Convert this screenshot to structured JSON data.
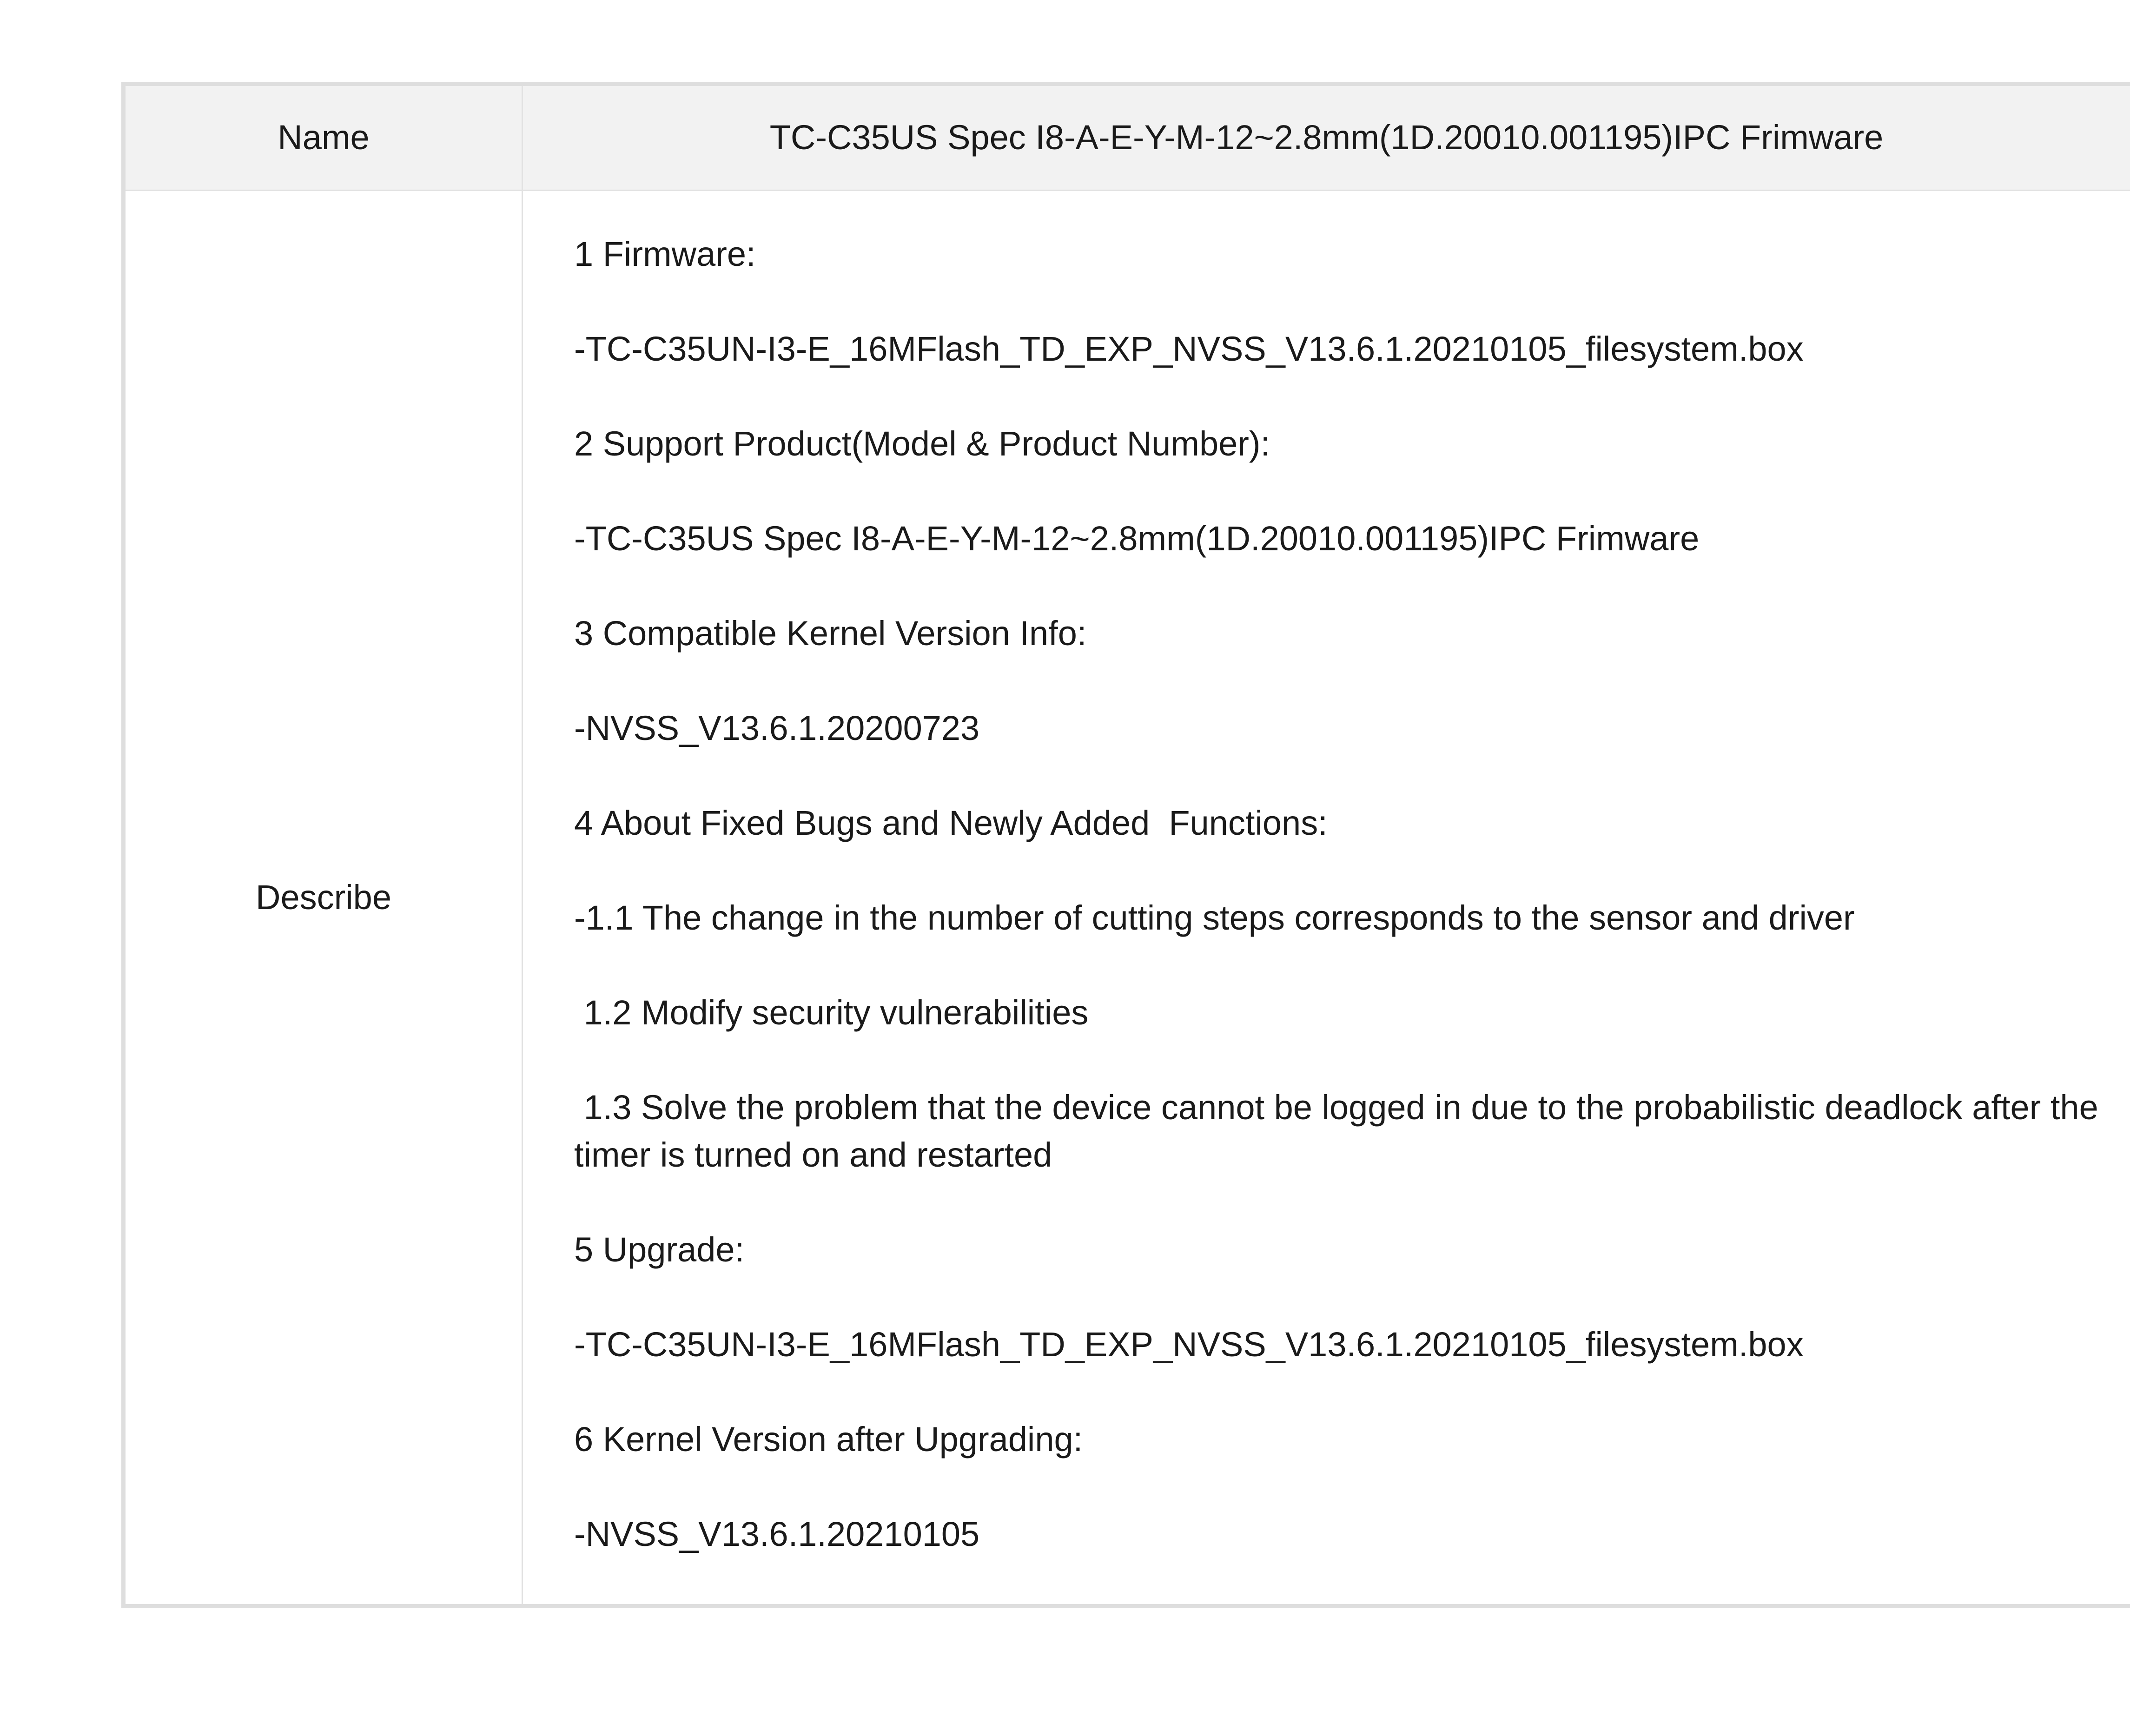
{
  "table": {
    "header": {
      "label": "Name",
      "value": "TC-C35US Spec I8-A-E-Y-M-12~2.8mm(1D.20010.001195)IPC Frimware"
    },
    "body": {
      "label": "Describe",
      "lines": [
        "1 Firmware:",
        "-TC-C35UN-I3-E_16MFlash_TD_EXP_NVSS_V13.6.1.20210105_filesystem.box",
        "2 Support Product(Model & Product Number):",
        "-TC-C35US Spec I8-A-E-Y-M-12~2.8mm(1D.20010.001195)IPC Frimware",
        "3 Compatible Kernel Version Info:",
        "-NVSS_V13.6.1.20200723",
        "4 About Fixed Bugs and Newly Added  Functions:",
        "-1.1 The change in the number of cutting steps corresponds to the sensor and driver",
        " 1.2 Modify security vulnerabilities",
        " 1.3 Solve the problem that the device cannot be logged in due to the probabilistic deadlock after the timer is turned on and restarted",
        "5 Upgrade:",
        "-TC-C35UN-I3-E_16MFlash_TD_EXP_NVSS_V13.6.1.20210105_filesystem.box",
        "6 Kernel Version after Upgrading:",
        "-NVSS_V13.6.1.20210105"
      ]
    }
  }
}
